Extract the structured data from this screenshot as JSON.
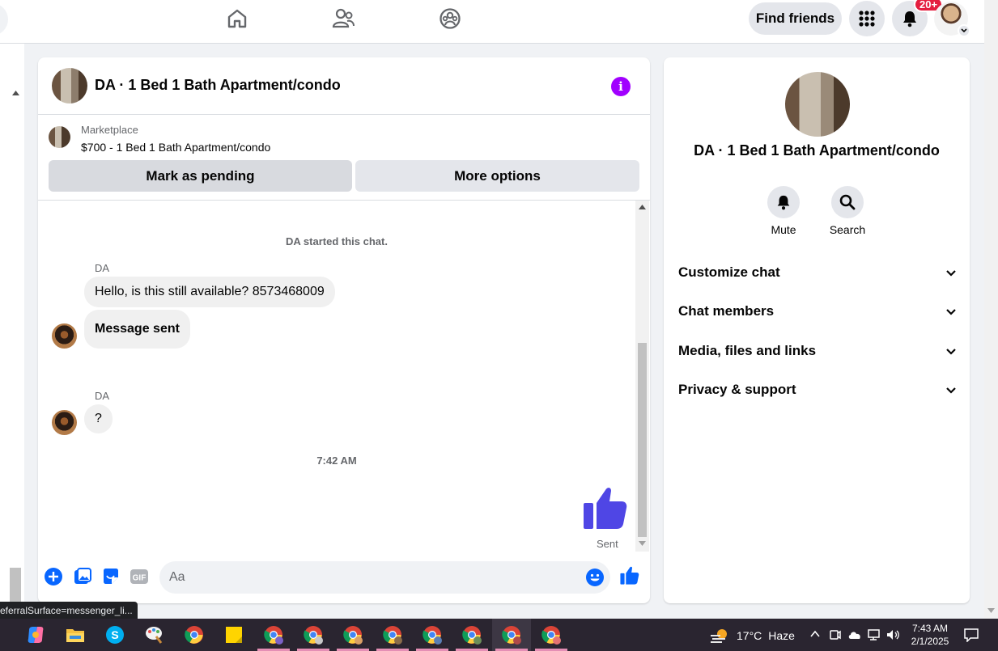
{
  "topbar": {
    "find_friends_label": "Find friends",
    "notification_badge": "20+"
  },
  "chat": {
    "title": "DA · 1 Bed 1 Bath Apartment/condo",
    "marketplace_label": "Marketplace",
    "listing": "$700 - 1 Bed 1 Bath Apartment/condo",
    "mark_pending_label": "Mark as pending",
    "more_options_label": "More options",
    "started_text": "DA started this chat.",
    "messages": [
      {
        "sender": "DA",
        "text": "Hello, is this still available? 8573468009"
      },
      {
        "text": "Message sent"
      },
      {
        "sender": "DA",
        "text": "?"
      }
    ],
    "timestamp": "7:42 AM",
    "sent_status": "Sent",
    "composer_placeholder": "Aa",
    "gif_label": "GIF"
  },
  "panel": {
    "title": "DA · 1 Bed 1 Bath Apartment/condo",
    "mute_label": "Mute",
    "search_label": "Search",
    "sections": [
      "Customize chat",
      "Chat members",
      "Media, files and links",
      "Privacy & support"
    ]
  },
  "status_url": "eferralSurface=messenger_li...",
  "taskbar": {
    "temperature": "17°C",
    "weather": "Haze",
    "time": "7:43 AM",
    "date": "2/1/2025"
  },
  "colors": {
    "accent": "#0866ff",
    "like_blue": "#4f46e5",
    "info_purple": "#a100ff",
    "badge_red": "#e41e3f"
  }
}
